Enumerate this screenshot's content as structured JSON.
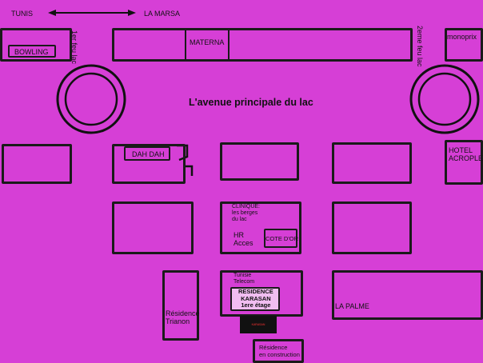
{
  "direction": {
    "left": "TUNIS",
    "right": "LA MARSA"
  },
  "title": "L'avenue principale du lac",
  "labels": {
    "bowling": "BOWLING",
    "feu1": "1er feu lac",
    "materna": "MATERNA",
    "feu2": "2eme feu lac",
    "monoprix": "monoprix",
    "dahdah": "DAH DAH",
    "hotel": "HOTEL\nACROPLE",
    "clinique": "CLINIQUE:\nles berges\ndu lac",
    "hr": "HR\nAcces",
    "cotedor": "COTE D'OR",
    "tunisie_telecom": "Tunisie\nTelecom",
    "residence_karasan": "RESIDENCE\nKARASAN\n1ere étage",
    "residence_trianon": "Résidence\nTrianon",
    "lapalme": "LA PALME",
    "residence_construction": "Résidence\nen construction",
    "sign": "KARASAN"
  },
  "colors": {
    "background": "#d63fd6",
    "outline": "#1a1a1a",
    "highlight": "#f1bdf1"
  }
}
